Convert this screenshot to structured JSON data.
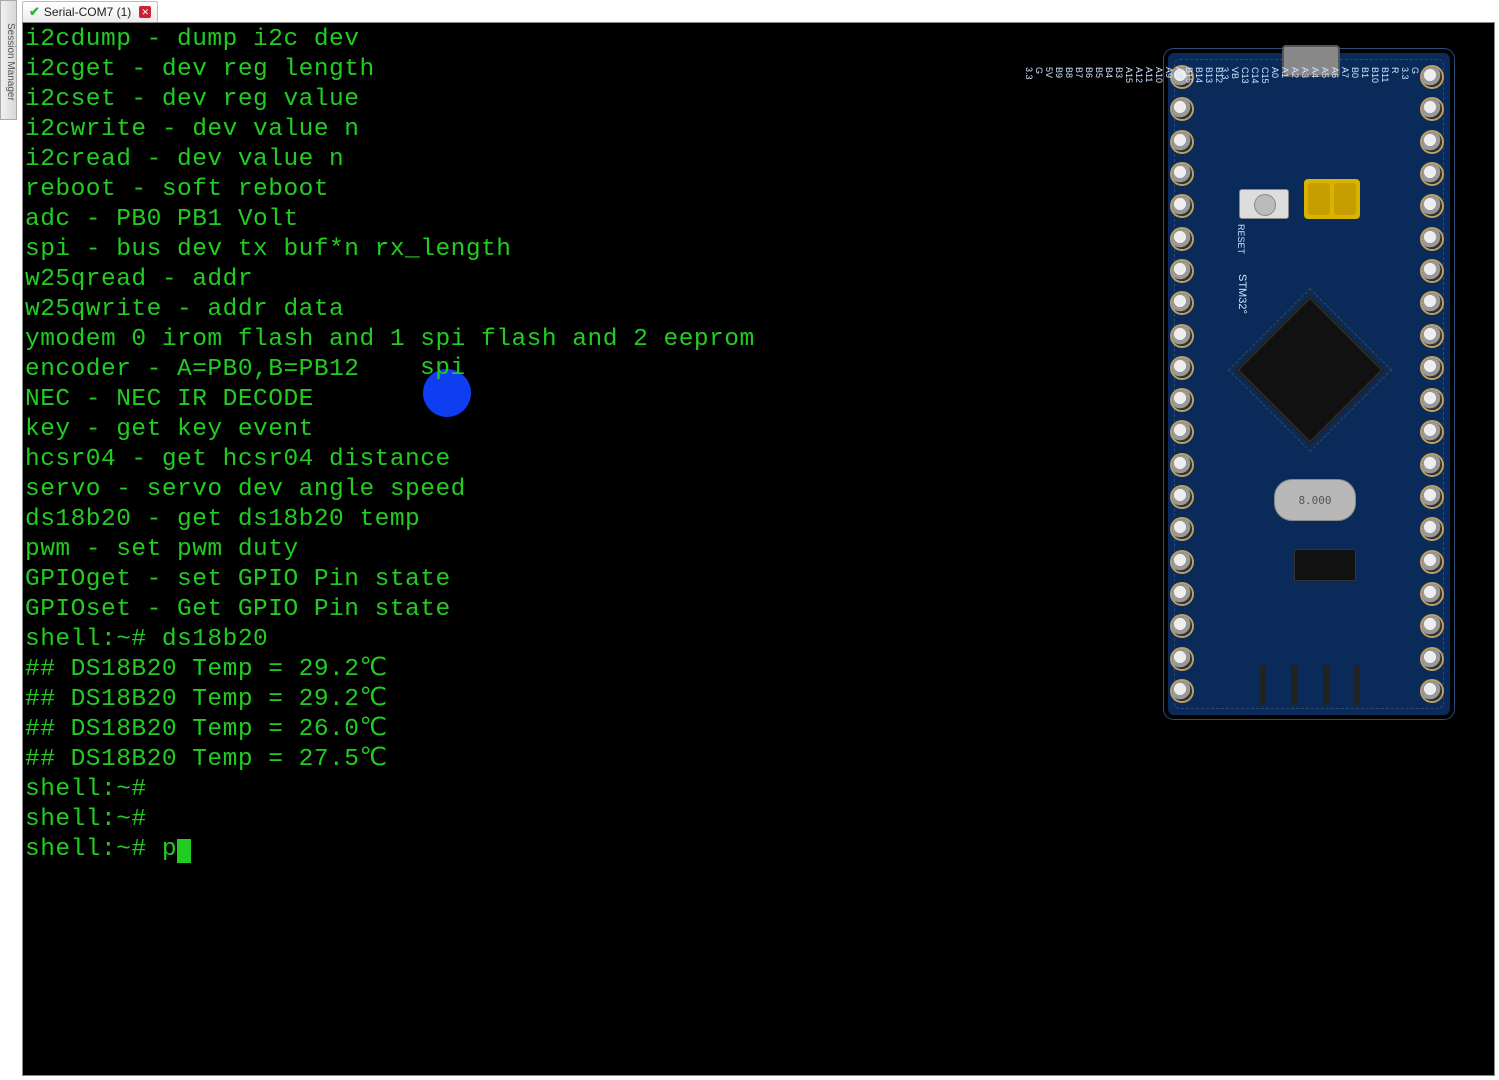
{
  "sidebar": {
    "label": "Session Manager"
  },
  "tabs": [
    {
      "title": "Serial-COM7 (1)"
    }
  ],
  "highlight_word": "spi",
  "terminal": {
    "lines": [
      "i2cdump - dump i2c dev",
      "i2cget - dev reg length",
      "i2cset - dev reg value",
      "i2cwrite - dev value n",
      "i2cread - dev value n",
      "reboot - soft reboot",
      "adc - PB0 PB1 Volt",
      "spi - bus dev tx buf*n rx_length",
      "w25qread - addr",
      "w25qwrite - addr data",
      "ymodem 0 irom flash and 1 spi flash and 2 eeprom",
      "encoder - A=PB0,B=PB12",
      "NEC - NEC IR DECODE",
      "key - get key event",
      "hcsr04 - get hcsr04 distance",
      "servo - servo dev angle speed",
      "ds18b20 - get ds18b20 temp",
      "pwm - set pwm duty",
      "GPIOget - set GPIO Pin state",
      "GPIOset - Get GPIO Pin state",
      "shell:~# ds18b20",
      "## DS18B20 Temp = 29.2℃",
      "## DS18B20 Temp = 29.2℃",
      "## DS18B20 Temp = 26.0℃",
      "## DS18B20 Temp = 27.5℃",
      "shell:~# ",
      "shell:~# "
    ],
    "prompt_line": "shell:~# p"
  },
  "board": {
    "chip": "STM32°",
    "reset": "RESET",
    "xtal": "8.000",
    "left_pins": [
      "B12",
      "B13",
      "B14",
      "B15",
      "A8",
      "A9",
      "A10",
      "A11",
      "A12",
      "A15",
      "B3",
      "B4",
      "B5",
      "B6",
      "B7",
      "B8",
      "B9",
      "5V",
      "G",
      "3.3"
    ],
    "right_pins": [
      "G",
      "3.3",
      "R",
      "B11",
      "B10",
      "B1",
      "B0",
      "A7",
      "A6",
      "A5",
      "A4",
      "A3",
      "A2",
      "A1",
      "A0",
      "C15",
      "C14",
      "C13",
      "VB",
      "3.3"
    ]
  }
}
